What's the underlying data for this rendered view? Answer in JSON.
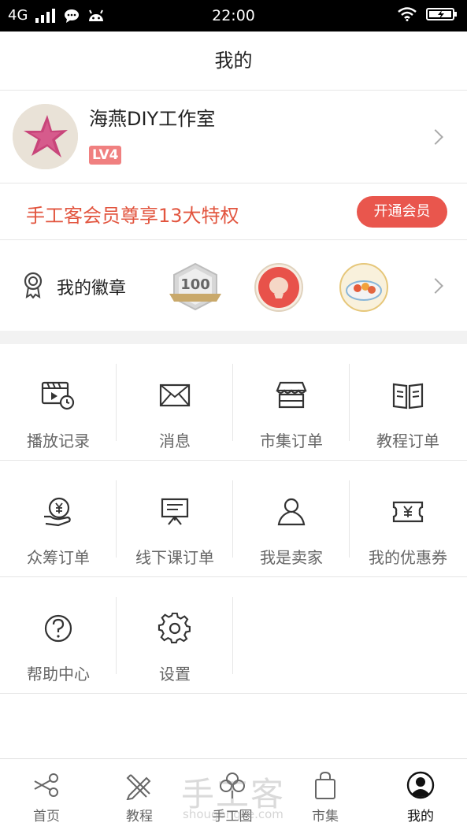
{
  "status_bar": {
    "network": "4G",
    "time": "22:00"
  },
  "header": {
    "title": "我的"
  },
  "profile": {
    "name": "海燕DIY工作室",
    "level": "LV4"
  },
  "membership": {
    "promo_text": "手工客会员尊享13大特权",
    "button_label": "开通会员"
  },
  "badges": {
    "label": "我的徽章",
    "items": [
      {
        "icon": "badge-100-icon",
        "text": "100"
      },
      {
        "icon": "badge-lantern-icon"
      },
      {
        "icon": "badge-bowl-icon"
      }
    ]
  },
  "menu": {
    "items": [
      {
        "label": "播放记录",
        "icon": "play-history-icon"
      },
      {
        "label": "消息",
        "icon": "envelope-icon"
      },
      {
        "label": "市集订单",
        "icon": "store-icon"
      },
      {
        "label": "教程订单",
        "icon": "book-icon"
      },
      {
        "label": "众筹订单",
        "icon": "crowdfunding-icon"
      },
      {
        "label": "线下课订单",
        "icon": "presentation-icon"
      },
      {
        "label": "我是卖家",
        "icon": "seller-icon"
      },
      {
        "label": "我的优惠券",
        "icon": "coupon-icon"
      },
      {
        "label": "帮助中心",
        "icon": "help-icon"
      },
      {
        "label": "设置",
        "icon": "gear-icon"
      }
    ]
  },
  "tabbar": {
    "items": [
      {
        "label": "首页",
        "icon": "scissors-icon",
        "active": false
      },
      {
        "label": "教程",
        "icon": "tools-icon",
        "active": false
      },
      {
        "label": "手工圈",
        "icon": "flower-icon",
        "active": false
      },
      {
        "label": "市集",
        "icon": "shopping-bag-icon",
        "active": false
      },
      {
        "label": "我的",
        "icon": "user-icon",
        "active": true
      }
    ]
  },
  "watermark": {
    "text": "手工客",
    "url": "shougongke.com"
  },
  "colors": {
    "accent": "#e9564d",
    "promo_text": "#e2553f",
    "level_badge": "#f08080"
  }
}
